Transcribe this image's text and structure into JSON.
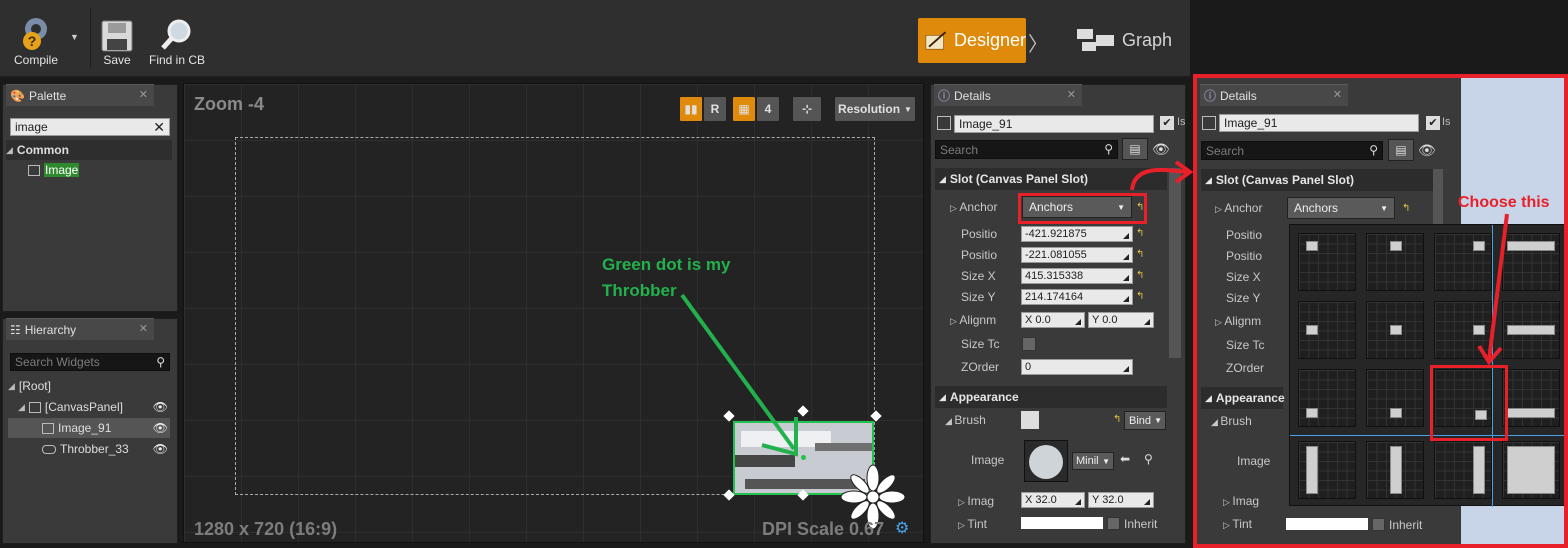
{
  "toolbar": {
    "compile_label": "Compile",
    "save_label": "Save",
    "find_label": "Find in CB",
    "designer_label": "Designer",
    "graph_label": "Graph"
  },
  "palette": {
    "tab_label": "Palette",
    "search_value": "image",
    "category": "Common",
    "item": "Image"
  },
  "hierarchy": {
    "tab_label": "Hierarchy",
    "search_placeholder": "Search Widgets",
    "items": [
      "[Root]",
      "[CanvasPanel]",
      "Image_91",
      "Throbber_33"
    ]
  },
  "canvas": {
    "zoom_label": "Zoom -4",
    "resolution_label": "Resolution",
    "r_label": "R",
    "grid_value": "4",
    "bottom_left": "1280 x 720 (16:9)",
    "bottom_right": "DPI Scale 0.67",
    "annotation": "Green dot is my Throbber"
  },
  "details": {
    "tab_label": "Details",
    "name_value": "Image_91",
    "is_variable": "Is",
    "search_placeholder": "Search",
    "slot_section": "Slot (Canvas Panel Slot)",
    "anchors_label": "Anchor",
    "anchors_value": "Anchors",
    "position_label": "Positio",
    "position_x": "-421.921875",
    "position_y": "-221.081055",
    "size_x_label": "Size X",
    "size_x": "415.315338",
    "size_y_label": "Size Y",
    "size_y": "214.174164",
    "alignment_label": "Alignm",
    "align_x": "X  0.0",
    "align_y": "Y  0.0",
    "size_to_content_label": "Size Tc",
    "zorder_label": "ZOrder",
    "zorder_value": "0",
    "appearance_section": "Appearance",
    "brush_label": "Brush",
    "bind_label": "Bind",
    "image_label": "Image",
    "image_value": "Minil",
    "image_size_label": "Imag",
    "image_size_x": "X  32.0",
    "image_size_y": "Y  32.0",
    "tint_label": "Tint",
    "inherit_label": "Inherit"
  },
  "zoom_panel": {
    "name_value": "Image_91",
    "choose_label": "Choose this",
    "tint_label": "Tint",
    "inherit_label": "Inherit",
    "image_label": "Image",
    "image_size_label": "Imag",
    "brush_label": "Brush",
    "appearance_section": "Appearance",
    "zorder_label": "ZOrder",
    "size_tc_label": "Size Tc",
    "alignment_label": "Alignm",
    "size_y_label": "Size Y",
    "size_x_label": "Size X",
    "position_label": "Positio"
  },
  "colors": {
    "accent": "#e08a0b",
    "annotation_red": "#e8202a",
    "annotation_green": "#22b14c"
  }
}
